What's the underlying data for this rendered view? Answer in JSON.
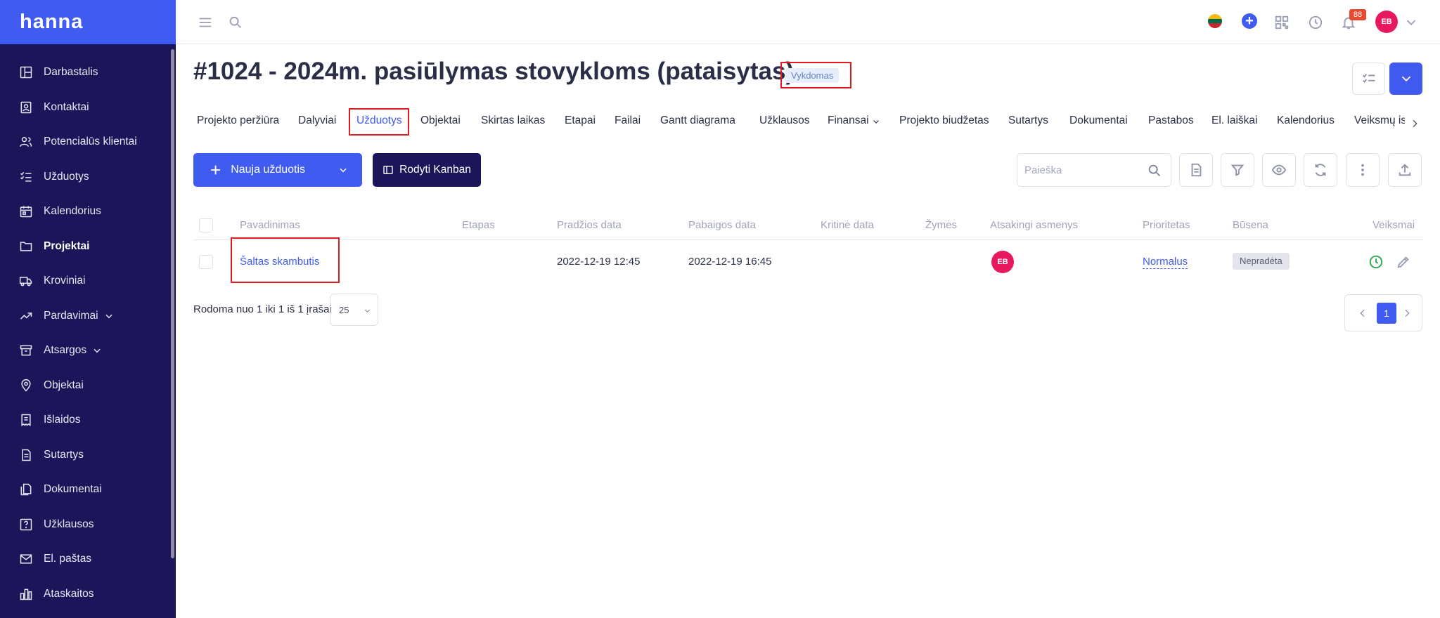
{
  "brand": "hanna",
  "sidebar": {
    "items": [
      {
        "label": "Darbastalis",
        "icon": "dashboard-icon"
      },
      {
        "label": "Kontaktai",
        "icon": "contacts-icon"
      },
      {
        "label": "Potencialūs klientai",
        "icon": "leads-icon"
      },
      {
        "label": "Užduotys",
        "icon": "tasks-icon"
      },
      {
        "label": "Kalendorius",
        "icon": "calendar-icon"
      },
      {
        "label": "Projektai",
        "icon": "folder-icon",
        "active": true
      },
      {
        "label": "Kroviniai",
        "icon": "truck-icon"
      },
      {
        "label": "Pardavimai",
        "icon": "trend-icon",
        "expandable": true
      },
      {
        "label": "Atsargos",
        "icon": "archive-icon",
        "expandable": true
      },
      {
        "label": "Objektai",
        "icon": "location-icon"
      },
      {
        "label": "Išlaidos",
        "icon": "receipt-icon"
      },
      {
        "label": "Sutartys",
        "icon": "contract-icon"
      },
      {
        "label": "Dokumentai",
        "icon": "documents-icon"
      },
      {
        "label": "Užklausos",
        "icon": "question-icon"
      },
      {
        "label": "El. paštas",
        "icon": "mail-icon"
      },
      {
        "label": "Ataskaitos",
        "icon": "reports-icon"
      }
    ]
  },
  "topbar": {
    "notification_count": "88",
    "user_initials": "EB",
    "icons": [
      "menu-icon",
      "search-icon",
      "lithuania-flag-icon",
      "add-circle-icon",
      "qr-code-icon",
      "clock-icon",
      "bell-icon",
      "chevron-down-icon"
    ]
  },
  "project": {
    "title": "#1024 - 2024m. pasiūlymas stovykloms (pataisytas)",
    "status": "Vykdomas"
  },
  "tabs": [
    {
      "label": "Projekto peržiūra"
    },
    {
      "label": "Dalyviai"
    },
    {
      "label": "Užduotys",
      "active": true
    },
    {
      "label": "Objektai"
    },
    {
      "label": "Skirtas laikas"
    },
    {
      "label": "Etapai"
    },
    {
      "label": "Failai"
    },
    {
      "label": "Gantt diagrama"
    },
    {
      "label": "Užklausos"
    },
    {
      "label": "Finansai",
      "dropdown": true
    },
    {
      "label": "Projekto biudžetas"
    },
    {
      "label": "Sutartys"
    },
    {
      "label": "Dokumentai"
    },
    {
      "label": "Pastabos"
    },
    {
      "label": "El. laiškai"
    },
    {
      "label": "Kalendorius"
    },
    {
      "label": "Veiksmų is"
    }
  ],
  "actions": {
    "new_task": "Nauja užduotis",
    "kanban": "Rodyti Kanban",
    "search_placeholder": "Paieška"
  },
  "table": {
    "columns": [
      "Pavadinimas",
      "Etapas",
      "Pradžios data",
      "Pabaigos data",
      "Kritinė data",
      "Žymės",
      "Atsakingi asmenys",
      "Prioritetas",
      "Būsena",
      "Veiksmai"
    ],
    "rows": [
      {
        "name": "Šaltas skambutis",
        "stage": "",
        "start": "2022-12-19 12:45",
        "end": "2022-12-19 16:45",
        "critical": "",
        "tags": "",
        "assignee_initials": "EB",
        "priority": "Normalus",
        "status": "Nepradėta"
      }
    ]
  },
  "footer": {
    "info": "Rodoma nuo 1 iki 1 iš 1 įrašai",
    "page_size": "25",
    "current_page": "1"
  },
  "colors": {
    "sidebar_bg": "#1c1559",
    "brand_bg": "#3f5bf0",
    "accent": "#3f5bf0",
    "highlight_box": "#e11b22",
    "avatar": "#e8185e"
  }
}
